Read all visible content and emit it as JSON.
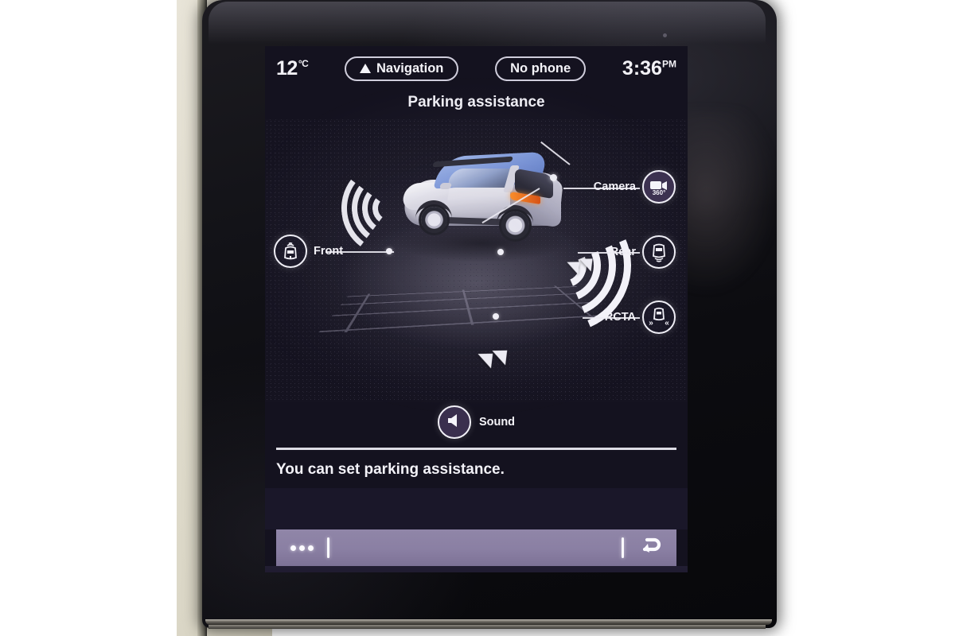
{
  "device": {
    "name": "car-infotainment-head-unit",
    "screen_bg": "#14121f"
  },
  "statusbar": {
    "temperature": "12",
    "temperature_unit": "°C",
    "navigation_label": "Navigation",
    "navigation_icon": "navigation-arrow-icon",
    "phone_label": "No phone",
    "clock_time": "3:36",
    "clock_ampm": "PM"
  },
  "header": {
    "title": "Parking assistance"
  },
  "illustration": {
    "name": "car-parking-sensor-diagram",
    "car_body_color": "#dedde6",
    "car_roof_color": "#7e99da",
    "sensor_arc_color": "#f0eff6",
    "front_arc_count": 4,
    "rear_arc_count": 4,
    "chevron_count": 4
  },
  "callouts": [
    {
      "id": "front",
      "label": "Front",
      "icon": "car-front-sensor-icon",
      "state": "outline",
      "position": "left-middle"
    },
    {
      "id": "camera",
      "label": "Camera",
      "icon": "camera-360-icon",
      "badge": "360°",
      "state": "active",
      "position": "right-top"
    },
    {
      "id": "rear",
      "label": "Rear",
      "icon": "car-rear-sensor-icon",
      "state": "outline",
      "position": "right-middle"
    },
    {
      "id": "rcta",
      "label": "RCTA",
      "icon": "car-rear-cross-traffic-alert-icon",
      "state": "outline",
      "position": "right-bottom"
    }
  ],
  "sound": {
    "label": "Sound",
    "icon": "speaker-icon",
    "state": "active"
  },
  "hint": {
    "text": "You can set parking assistance."
  },
  "actionbar": {
    "accent_color": "#8a7fa3",
    "overflow_icon": "more-options-icon",
    "overflow_label": "•••",
    "back_icon": "back-arrow-icon"
  },
  "bottomnav": {
    "items": [
      {
        "id": "power",
        "icon": "power-icon"
      },
      {
        "id": "apps",
        "icon": "apps-grid-icon"
      },
      {
        "id": "home",
        "icon": "home-icon"
      },
      {
        "id": "volume-down",
        "icon": "volume-down-icon"
      },
      {
        "id": "volume-up",
        "icon": "volume-up-icon"
      }
    ]
  }
}
